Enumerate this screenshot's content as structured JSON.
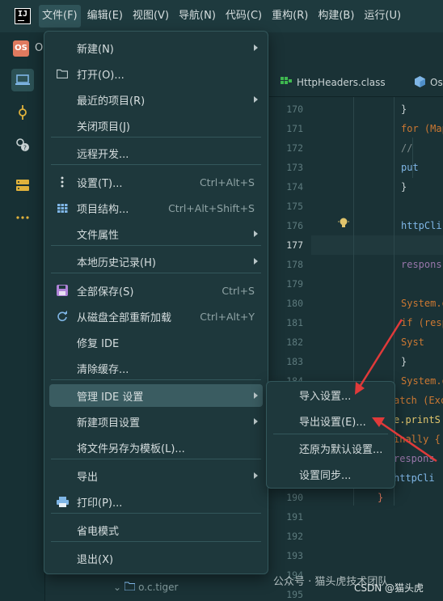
{
  "menubar": {
    "logo": "IJ",
    "items": [
      {
        "label": "文件(F)",
        "active": true
      },
      {
        "label": "编辑(E)"
      },
      {
        "label": "视图(V)"
      },
      {
        "label": "导航(N)"
      },
      {
        "label": "代码(C)"
      },
      {
        "label": "重构(R)"
      },
      {
        "label": "构建(B)"
      },
      {
        "label": "运行(U)"
      }
    ]
  },
  "project": {
    "badge": "OS",
    "name_partial": "O"
  },
  "tabs": [
    {
      "label": "HttpHeaders.class",
      "icon": "class-file-icon"
    },
    {
      "label": "Os",
      "icon": "cube-icon"
    }
  ],
  "file_menu": {
    "items": [
      {
        "label": "新建(N)",
        "submenu": true
      },
      {
        "label": "打开(O)...",
        "icon": "folder-icon"
      },
      {
        "label": "最近的项目(R)",
        "submenu": true
      },
      {
        "label": "关闭项目(J)"
      },
      {
        "label": "远程开发..."
      },
      {
        "label": "设置(T)...",
        "shortcut": "Ctrl+Alt+S",
        "icon": "kebab-icon"
      },
      {
        "label": "项目结构...",
        "shortcut": "Ctrl+Alt+Shift+S",
        "icon": "grid-icon"
      },
      {
        "label": "文件属性",
        "submenu": true
      },
      {
        "label": "本地历史记录(H)",
        "submenu": true
      },
      {
        "label": "全部保存(S)",
        "shortcut": "Ctrl+S",
        "icon": "save-icon"
      },
      {
        "label": "从磁盘全部重新加载",
        "shortcut": "Ctrl+Alt+Y",
        "icon": "reload-icon"
      },
      {
        "label": "修复 IDE"
      },
      {
        "label": "清除缓存..."
      },
      {
        "label": "管理 IDE 设置",
        "submenu": true,
        "highlighted": true
      },
      {
        "label": "新建项目设置",
        "submenu": true
      },
      {
        "label": "将文件另存为模板(L)..."
      },
      {
        "label": "导出",
        "submenu": true
      },
      {
        "label": "打印(P)...",
        "icon": "print-icon"
      },
      {
        "label": "省电模式"
      },
      {
        "label": "退出(X)"
      }
    ]
  },
  "settings_submenu": {
    "items": [
      {
        "label": "导入设置..."
      },
      {
        "label": "导出设置(E)..."
      },
      {
        "label": "还原为默认设置..."
      },
      {
        "label": "设置同步..."
      }
    ]
  },
  "gutter": {
    "lines": [
      "170",
      "171",
      "172",
      "173",
      "174",
      "175",
      "176",
      "177",
      "178",
      "179",
      "180",
      "181",
      "182",
      "183",
      "184",
      "185",
      "186",
      "187",
      "188",
      "189",
      "190",
      "191",
      "192",
      "193",
      "194",
      "195"
    ],
    "current": "177"
  },
  "code": {
    "lines": [
      {
        "text": "}",
        "color": "#c9d3d4"
      },
      {
        "text": "for (Map",
        "color": "#cc7832"
      },
      {
        "text": "  // ",
        "color": "#7f8c8d"
      },
      {
        "text": "  put",
        "color": "#7fb6e6"
      },
      {
        "text": "}",
        "color": "#c9d3d4"
      },
      {
        "text": "",
        "color": "#c9d3d4"
      },
      {
        "text": "httpCli",
        "color": "#7fb6e6"
      },
      {
        "text": "",
        "color": "#c9d3d4"
      },
      {
        "text": "respons",
        "color": "#9876aa"
      },
      {
        "text": "",
        "color": "#c9d3d4"
      },
      {
        "text": "System.o",
        "color": "#cc7832"
      },
      {
        "text": "if (resp",
        "color": "#cc7832"
      },
      {
        "text": "  Syst",
        "color": "#cc7832"
      },
      {
        "text": "}",
        "color": "#c9d3d4"
      },
      {
        "text": "System.o",
        "color": "#cc7832"
      },
      {
        "text": "atch (Exc",
        "color": "#cc7832"
      },
      {
        "text": "e.printS",
        "color": "#e0c46c"
      },
      {
        "text": "inally {",
        "color": "#cc7832"
      },
      {
        "text": "respons",
        "color": "#9876aa"
      },
      {
        "text": "httpCli",
        "color": "#7fb6e6"
      },
      {
        "text": "}",
        "color": "#e07a5f"
      }
    ]
  },
  "tree": {
    "label": "o.c.tiger"
  },
  "watermark": {
    "line1": "公众号 · 猫头虎技术团队",
    "line2": "CSDN @猫头虎"
  },
  "colors": {
    "arrow": "#e03a3a",
    "accent": "#3a5c61"
  }
}
